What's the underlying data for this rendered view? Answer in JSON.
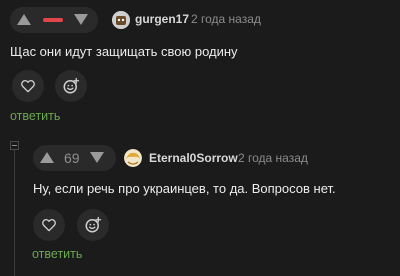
{
  "comments": [
    {
      "username": "gurgen17",
      "timestamp": "2 года назад",
      "text": "Щас они идут защищать свою родину",
      "rating": "",
      "rating_color": "#e0464a",
      "reply_label": "ответить"
    },
    {
      "username": "Eternal0Sorrow",
      "timestamp": "2 года назад",
      "text": "Ну, если речь про украинцев, то да. Вопросов нет.",
      "rating": "69",
      "reply_label": "ответить"
    }
  ],
  "icons": [
    "upvote-icon",
    "downvote-icon",
    "heart-icon",
    "emoji-add-icon",
    "thread-collapse-icon"
  ],
  "colors": {
    "background": "#1b1b1b",
    "button_bg": "#2a2a2a",
    "reply_link": "#6aa84f",
    "negative_rating": "#e0464a"
  }
}
